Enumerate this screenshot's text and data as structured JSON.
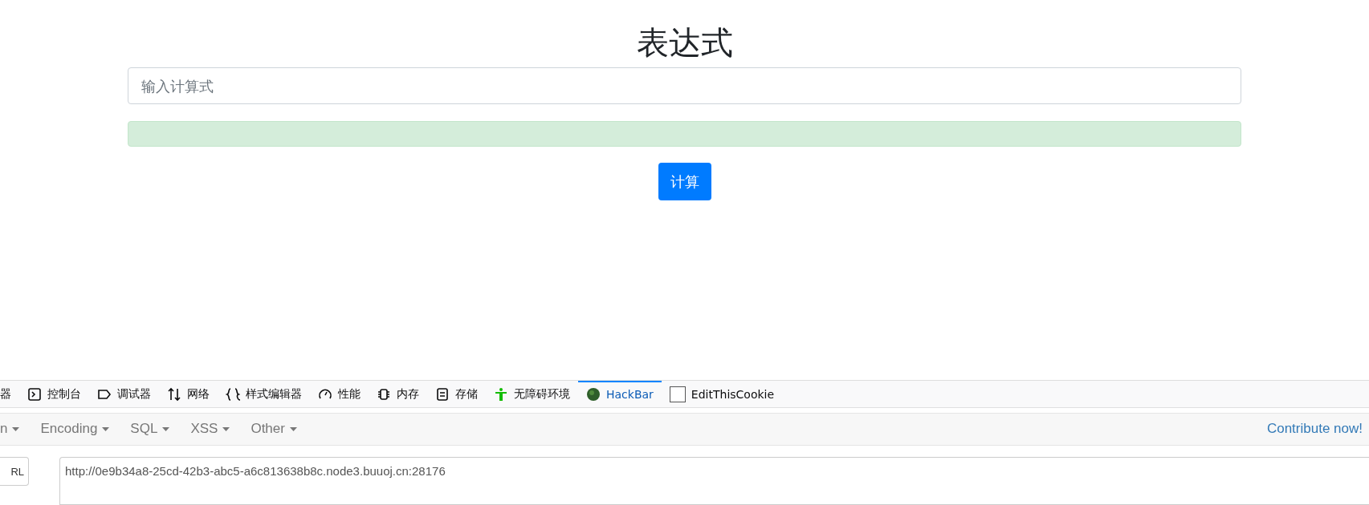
{
  "page": {
    "title": "表达式",
    "input": {
      "placeholder": "输入计算式"
    },
    "button": "计算"
  },
  "devtools": {
    "tabs": [
      {
        "label": "器",
        "kind": "none",
        "selected": false
      },
      {
        "label": "控制台",
        "kind": "console",
        "selected": false
      },
      {
        "label": "调试器",
        "kind": "debugger",
        "selected": false
      },
      {
        "label": "网络",
        "kind": "network",
        "selected": false
      },
      {
        "label": "样式编辑器",
        "kind": "style",
        "selected": false
      },
      {
        "label": "性能",
        "kind": "performance",
        "selected": false
      },
      {
        "label": "内存",
        "kind": "memory",
        "selected": false
      },
      {
        "label": "存储",
        "kind": "storage",
        "selected": false
      },
      {
        "label": "无障碍环境",
        "kind": "accessibility",
        "selected": false
      },
      {
        "label": "HackBar",
        "kind": "hackbar",
        "selected": true
      },
      {
        "label": "EditThisCookie",
        "kind": "cookie",
        "selected": false
      }
    ]
  },
  "hackbar": {
    "menus": [
      "n",
      "Encoding",
      "SQL",
      "XSS",
      "Other"
    ],
    "contribute": "Contribute now!",
    "url_button": "RL",
    "url": "http://0e9b34a8-25cd-42b3-abc5-a6c813638b8c.node3.buuoj.cn:28176"
  }
}
